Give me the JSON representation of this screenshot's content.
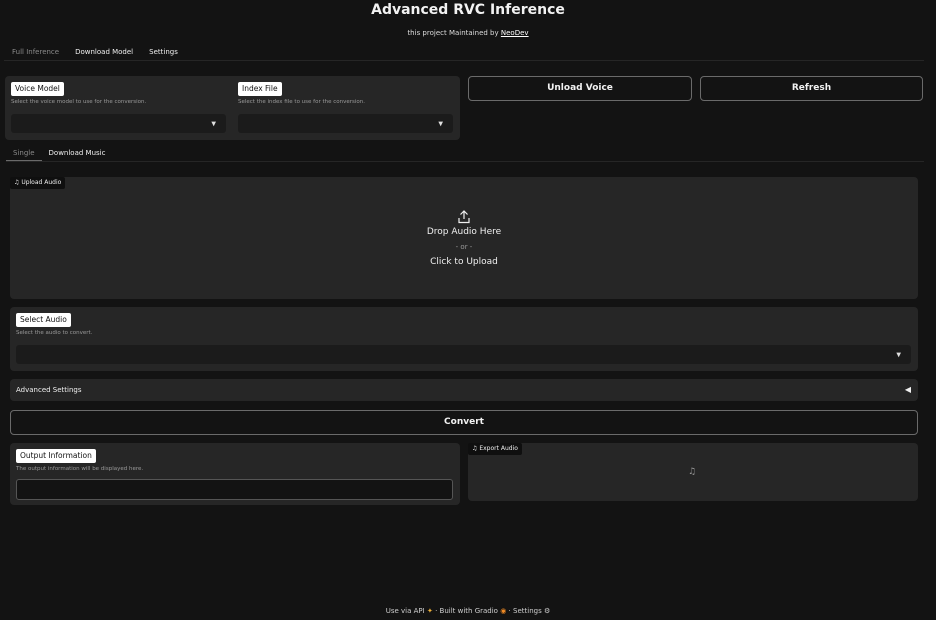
{
  "header": {
    "title": "Advanced RVC Inference",
    "subtitle_prefix": "this project Maintained by",
    "subtitle_link": "NeoDev"
  },
  "main_tabs": [
    {
      "label": "Full Inference"
    },
    {
      "label": "Download Model"
    },
    {
      "label": "Settings"
    }
  ],
  "voice_model": {
    "label": "Voice Model",
    "description": "Select the voice model to use for the conversion.",
    "value": ""
  },
  "index_file": {
    "label": "Index File",
    "description": "Select the index file to use for the conversion.",
    "value": ""
  },
  "buttons": {
    "unload_voice": "Unload Voice",
    "refresh": "Refresh",
    "convert": "Convert"
  },
  "sub_tabs": [
    {
      "label": "Single"
    },
    {
      "label": "Download Music"
    }
  ],
  "upload": {
    "badge": "Upload Audio",
    "line1": "Drop Audio Here",
    "line2": "- or -",
    "line3": "Click to Upload"
  },
  "select_audio": {
    "label": "Select Audio",
    "description": "Select the audio to convert.",
    "value": ""
  },
  "advanced": {
    "label": "Advanced Settings",
    "arrow": "◀"
  },
  "output_info": {
    "label": "Output Information",
    "description": "The output information will be displayed here.",
    "value": ""
  },
  "export_audio": {
    "badge": "Export Audio"
  },
  "footer": {
    "api": "Use via API",
    "sep1": "·",
    "built": "Built with Gradio",
    "sep2": "·",
    "settings": "Settings"
  }
}
